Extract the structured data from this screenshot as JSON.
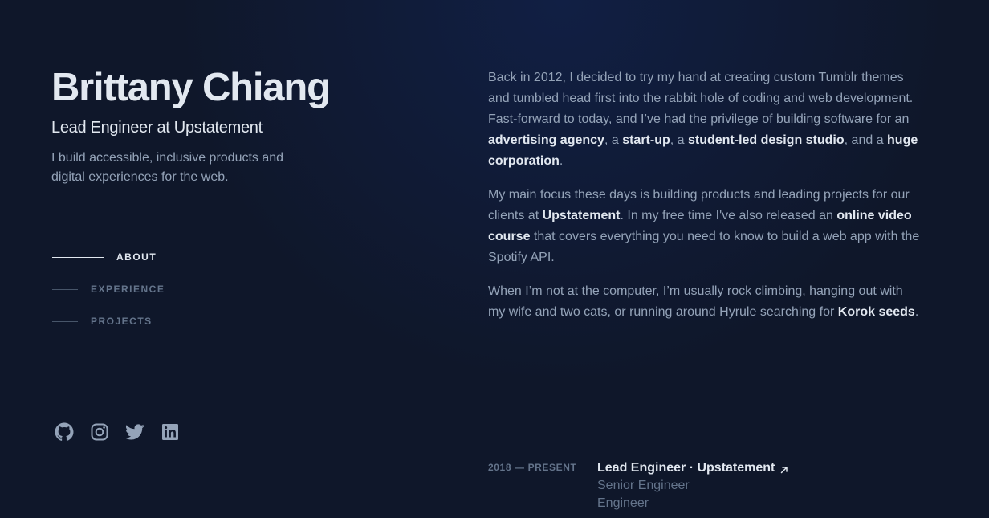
{
  "header": {
    "name": "Brittany Chiang",
    "role": "Lead Engineer at Upstatement",
    "tagline": "I build accessible, inclusive products and digital experiences for the web."
  },
  "nav": {
    "items": [
      {
        "label": "About",
        "active": true
      },
      {
        "label": "Experience",
        "active": false
      },
      {
        "label": "Projects",
        "active": false
      }
    ]
  },
  "socials": [
    {
      "icon": "github-icon",
      "label": "GitHub"
    },
    {
      "icon": "instagram-icon",
      "label": "Instagram"
    },
    {
      "icon": "twitter-icon",
      "label": "Twitter"
    },
    {
      "icon": "linkedin-icon",
      "label": "LinkedIn"
    }
  ],
  "about": {
    "p1": {
      "t1": "Back in 2012, I decided to try my hand at creating custom Tumblr themes and tumbled head first into the rabbit hole of coding and web development. Fast-forward to today, and I’ve had the privilege of building software for an ",
      "l1": "advertising agency",
      "t2": ", a ",
      "l2": "start-up",
      "t3": ", a ",
      "l3": "student-led design studio",
      "t4": ", and a ",
      "l4": "huge corporation",
      "t5": "."
    },
    "p2": {
      "t1": "My main focus these days is building products and leading projects for our clients at ",
      "l1": "Upstatement",
      "t2": ". In my free time I've also released an ",
      "l2": "online video course",
      "t3": " that covers everything you need to know to build a web app with the Spotify API."
    },
    "p3": {
      "t1": "When I’m not at the computer, I’m usually rock climbing, hanging out with my wife and two cats, or running around Hyrule searching for ",
      "l1": "Korok seeds",
      "t2": "."
    }
  },
  "experience": {
    "date": "2018 — Present",
    "title": "Lead Engineer · Upstatement",
    "subtitles": [
      "Senior Engineer",
      "Engineer"
    ]
  },
  "colors": {
    "background": "#0f172a",
    "text_primary": "#e2e8f0",
    "text_secondary": "#94a3b8",
    "text_muted": "#64748b"
  }
}
